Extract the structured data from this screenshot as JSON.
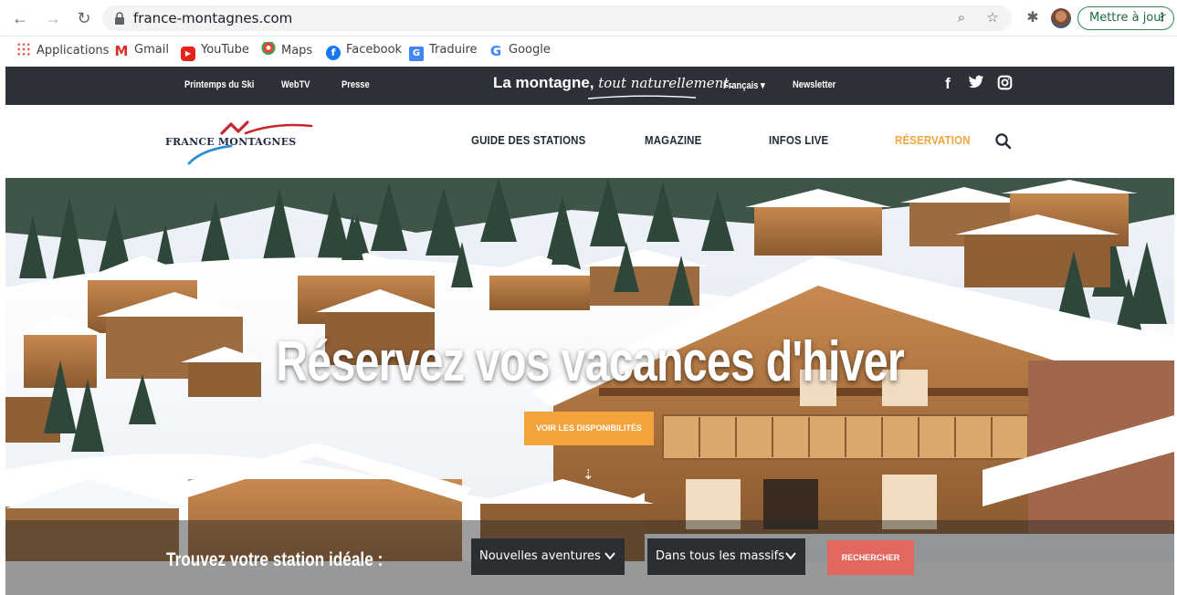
{
  "browser": {
    "url": "france-montagnes.com",
    "update_label": "Mettre à jour",
    "update_menu": "⋮",
    "nav_icons": [
      "back-icon",
      "forward-icon",
      "reload-icon"
    ],
    "bookmarks": [
      {
        "label": "Applications",
        "icon": "apps-grid-icon"
      },
      {
        "label": "Gmail",
        "icon": "gmail-icon"
      },
      {
        "label": "YouTube",
        "icon": "youtube-icon"
      },
      {
        "label": "Maps",
        "icon": "maps-pin-icon"
      },
      {
        "label": "Facebook",
        "icon": "facebook-icon"
      },
      {
        "label": "Traduire",
        "icon": "translate-icon"
      },
      {
        "label": "Google",
        "icon": "google-icon"
      }
    ]
  },
  "topbar": {
    "links": [
      "Printemps du Ski",
      "WebTV",
      "Presse"
    ],
    "tagline_bold": "La montagne,",
    "tagline_italic": "tout naturellement.",
    "language": "Français ▾",
    "newsletter": "Newsletter",
    "social_icons": [
      "facebook-icon",
      "twitter-icon",
      "instagram-icon"
    ]
  },
  "header": {
    "logo_text": "FRANCE MONTAGNES",
    "nav": [
      "GUIDE DES STATIONS",
      "MAGAZINE",
      "INFOS LIVE",
      "RÉSERVATION"
    ]
  },
  "hero": {
    "title": "Réservez vos vacances d'hiver",
    "cta": "VOIR LES DISPONIBILITÉS",
    "next_arrow": "›",
    "down_arrow": "⇣"
  },
  "search": {
    "label": "Trouvez votre station idéale :",
    "select_1": "Nouvelles aventures",
    "select_2": "Dans tous les massifs",
    "button": "RECHERCHER"
  },
  "colors": {
    "topbar_bg": "#2b3137",
    "accent_orange": "#f2a33c",
    "search_button": "#e2675f",
    "nav_text": "#1f2a37"
  }
}
